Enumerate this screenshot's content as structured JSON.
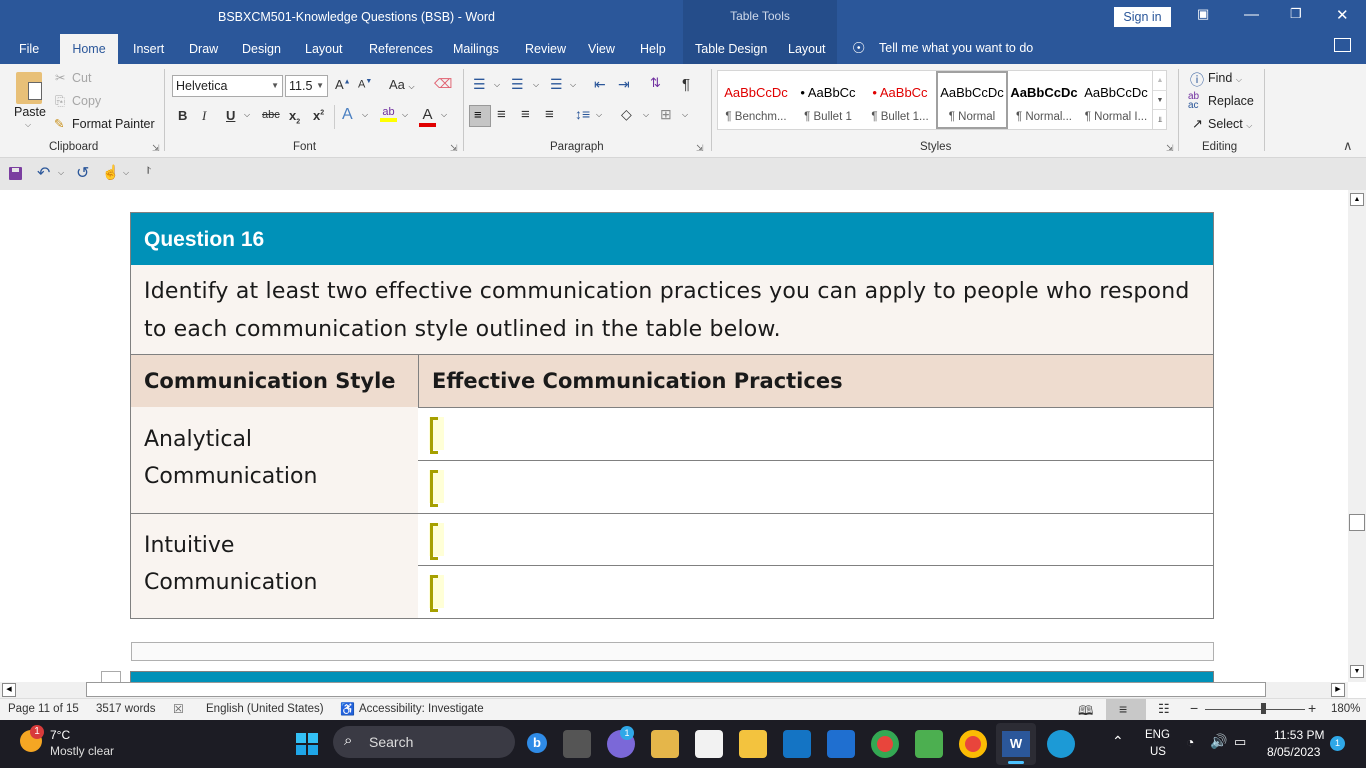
{
  "window": {
    "title": "BSBXCM501-Knowledge Questions (BSB)  -  Word",
    "contextual_group": "Table Tools",
    "sign_in": "Sign in",
    "controls": {
      "ribbon_display": "ribbon-display-icon",
      "minimize": "minimize-icon",
      "restore": "restore-icon",
      "close": "close-icon"
    }
  },
  "tabs": [
    "File",
    "Home",
    "Insert",
    "Draw",
    "Design",
    "Layout",
    "References",
    "Mailings",
    "Review",
    "View",
    "Help",
    "Table Design",
    "Layout"
  ],
  "active_tab": "Home",
  "tell_me": "Tell me what you want to do",
  "ribbon": {
    "clipboard": {
      "label": "Clipboard",
      "paste": "Paste",
      "cut": "Cut",
      "copy": "Copy",
      "format_painter": "Format Painter"
    },
    "font": {
      "label": "Font",
      "font_name": "Helvetica",
      "font_size": "11.5",
      "case": "Aa"
    },
    "paragraph": {
      "label": "Paragraph"
    },
    "styles": {
      "label": "Styles",
      "items": [
        {
          "preview": "AaBbCcDc",
          "name": "¶ Benchm...",
          "color": "#e00000"
        },
        {
          "preview": "• AaBbCc",
          "name": "¶ Bullet 1",
          "color": "#000000"
        },
        {
          "preview": "• AaBbCc",
          "name": "¶ Bullet 1...",
          "color": "#e00000"
        },
        {
          "preview": "AaBbCcDc",
          "name": "¶ Normal",
          "color": "#000000",
          "selected": true
        },
        {
          "preview": "AaBbCcDc",
          "name": "¶ Normal...",
          "color": "#000000",
          "bold": true
        },
        {
          "preview": "AaBbCcDc",
          "name": "¶ Normal I...",
          "color": "#000000"
        }
      ]
    },
    "editing": {
      "label": "Editing",
      "find": "Find",
      "replace": "Replace",
      "select": "Select"
    }
  },
  "document": {
    "question_title": "Question 16",
    "prompt": "Identify at least two effective communication practices you can apply to people who respond to each communication style outlined in the table below.",
    "headers": [
      "Communication Style",
      "Effective Communication Practices"
    ],
    "rows": [
      {
        "style": "Analytical Communication",
        "answers": [
          "",
          ""
        ]
      },
      {
        "style": "Intuitive Communication",
        "answers": [
          "",
          ""
        ]
      }
    ],
    "colors": {
      "header_blue": "#0091b8",
      "prompt_bg": "#f9f4f0",
      "col_header_bg": "#eedccf"
    }
  },
  "statusbar": {
    "page": "Page 11 of 15",
    "words": "3517 words",
    "language": "English (United States)",
    "accessibility": "Accessibility: Investigate",
    "zoom": "180%"
  },
  "taskbar": {
    "weather_temp": "7°C",
    "weather_desc": "Mostly clear",
    "weather_badge": "1",
    "search": "Search",
    "teams_badge": "1",
    "lang_top": "ENG",
    "lang_bottom": "US",
    "time": "11:53 PM",
    "date": "8/05/2023",
    "notification_count": "1"
  }
}
